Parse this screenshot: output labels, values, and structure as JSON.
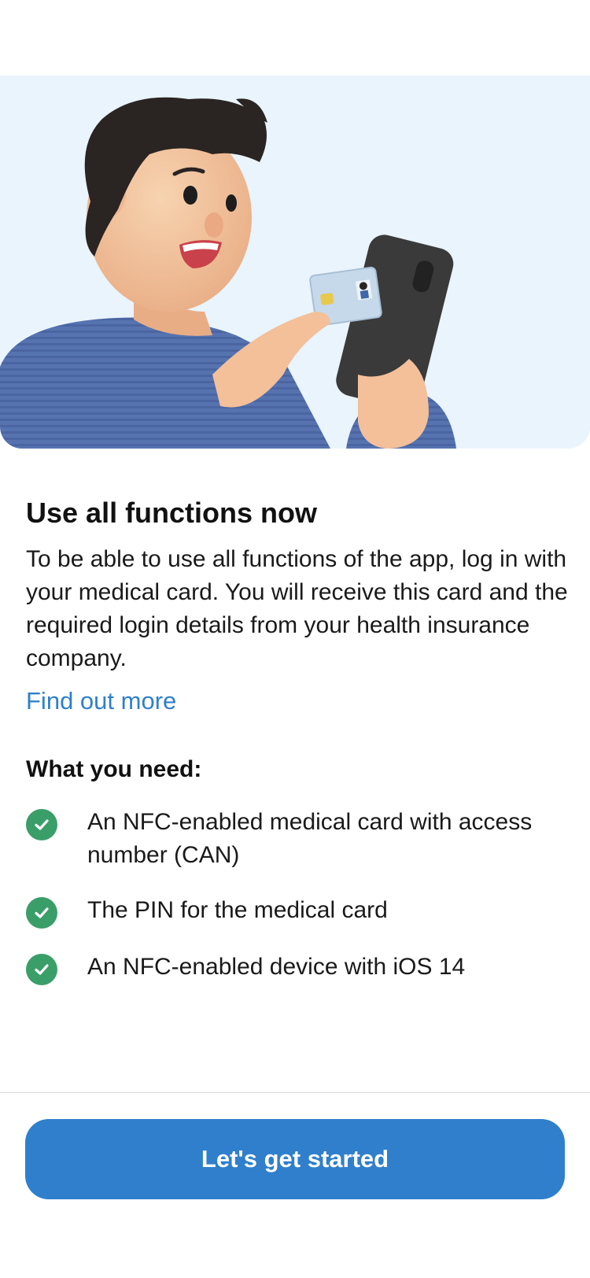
{
  "onboarding": {
    "illustration_icon": "person-holding-medical-card-and-phone-illustration",
    "title": "Use all functions now",
    "description": "To be able to use all functions of the app, log in with your medical card. You will receive this card and the required login details from your health insurance company.",
    "find_out_more_link": "Find out more",
    "needs_title": "What you need:",
    "requirements": [
      {
        "icon": "check-circle-icon",
        "text": "An NFC-enabled medical card with access number (CAN)"
      },
      {
        "icon": "check-circle-icon",
        "text": "The PIN for the medical card"
      },
      {
        "icon": "check-circle-icon",
        "text": "An NFC-enabled device with iOS 14"
      }
    ],
    "cta_label": "Let's get started"
  },
  "colors": {
    "accent": "#2f7fcd",
    "check": "#3a9e68",
    "hero_background": "#e9f4fc"
  }
}
